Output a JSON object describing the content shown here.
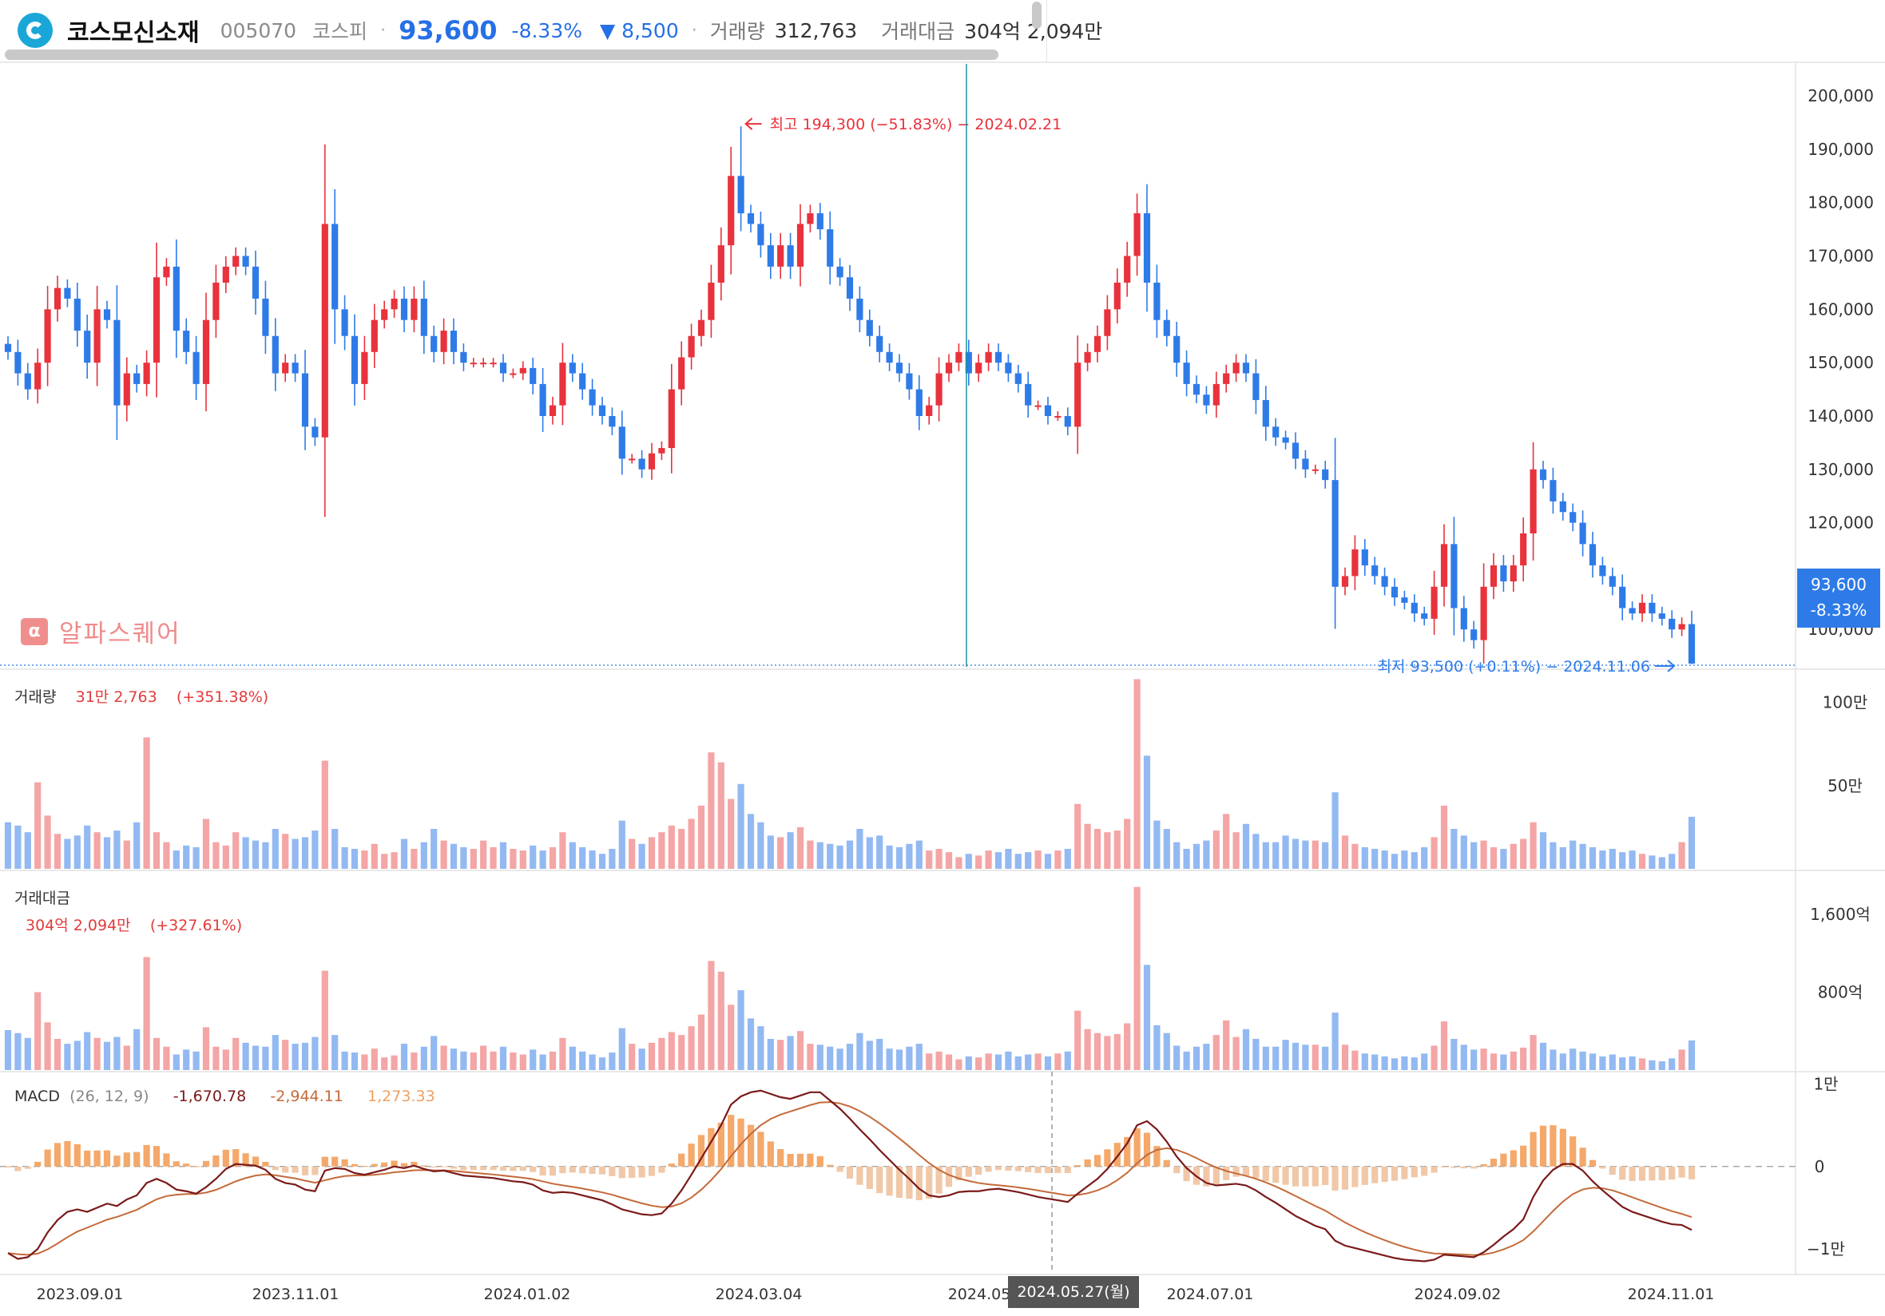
{
  "header": {
    "name": "코스모신소재",
    "code": "005070",
    "market": "코스피",
    "separator": "·",
    "price": "93,600",
    "change_rate": "-8.33%",
    "change_amount": "▼ 8,500",
    "volume_label": "거래량",
    "volume_value": "312,763",
    "amount_label": "거래대금",
    "amount_value": "304억 2,094만"
  },
  "brand": {
    "icon": "α",
    "text": "알파스퀘어"
  },
  "price_panel": {
    "high_annotation": "최고 194,300 (−51.83%) − 2024.02.21",
    "low_annotation": "최저 93,500 (+0.11%) − 2024.11.06",
    "current_badge_price": "93,600",
    "current_badge_rate": "-8.33%"
  },
  "volume_panel": {
    "label": "거래량",
    "value": "31만 2,763",
    "change": "(+351.38%)"
  },
  "amount_panel": {
    "label": "거래대금",
    "value": "304억 2,094만",
    "change": "(+327.61%)"
  },
  "macd_panel": {
    "label": "MACD",
    "params": "(26, 12, 9)",
    "macd": "-1,670.78",
    "signal": "-2,944.11",
    "hist": "1,273.33"
  },
  "crosshair_date": "2024.05.27(월)",
  "colors": {
    "up": "#e8323c",
    "down": "#2e7be8",
    "up_vol": "#f4a5a5",
    "down_vol": "#93b9f2",
    "macd": "#7a1a1a",
    "signal": "#c46a3a",
    "hist_pos": "#f4a86a",
    "hist_neg": "#f0c8a8"
  },
  "chart_data": [
    {
      "type": "candlestick",
      "series_name": "코스모신소재",
      "x_ticks": [
        "2023.09.01",
        "2023.11.01",
        "2024.01.02",
        "2024.03.04",
        "2024.05",
        "2024.07.01",
        "2024.09.02",
        "2024.11.01"
      ],
      "y_ticks": [
        "200,000",
        "190,000",
        "180,000",
        "170,000",
        "160,000",
        "150,000",
        "140,000",
        "130,000",
        "120,000",
        "110,000",
        "100,000"
      ],
      "ylim": [
        93000,
        206000
      ],
      "close": [
        152000,
        148000,
        145000,
        150000,
        160000,
        164000,
        162000,
        156000,
        150000,
        160000,
        158000,
        142000,
        148000,
        146000,
        150000,
        166000,
        168000,
        156000,
        152000,
        146000,
        158000,
        165000,
        168000,
        170000,
        168000,
        162000,
        155000,
        148000,
        150000,
        148000,
        138000,
        136000,
        176000,
        160000,
        155000,
        146000,
        152000,
        158000,
        160000,
        162000,
        158000,
        162000,
        155000,
        152000,
        156000,
        152000,
        150000,
        150000,
        150000,
        150000,
        148000,
        148000,
        149000,
        146000,
        140000,
        142000,
        150000,
        148000,
        145000,
        142000,
        140000,
        138000,
        132000,
        132000,
        130000,
        133000,
        134000,
        145000,
        151000,
        155000,
        158000,
        165000,
        172000,
        185000,
        178000,
        176000,
        172000,
        168000,
        172000,
        168000,
        176000,
        178000,
        175000,
        168000,
        166000,
        162000,
        158000,
        155000,
        152000,
        150000,
        148000,
        145000,
        140000,
        142000,
        148000,
        150000,
        152000,
        148000,
        150000,
        152000,
        150000,
        148000,
        146000,
        142000,
        142000,
        140000,
        140000,
        138000,
        150000,
        152000,
        155000,
        160000,
        165000,
        170000,
        178000,
        165000,
        158000,
        155000,
        150000,
        146000,
        144000,
        142000,
        146000,
        148000,
        150000,
        148000,
        143000,
        138000,
        136000,
        135000,
        132000,
        130000,
        130000,
        128000,
        108000,
        110000,
        115000,
        112000,
        110000,
        108000,
        106000,
        105000,
        103000,
        102000,
        108000,
        116000,
        104000,
        100000,
        98000,
        108000,
        112000,
        109000,
        112000,
        118000,
        130000,
        128000,
        124000,
        122000,
        120000,
        116000,
        112000,
        110000,
        108000,
        104000,
        103000,
        105000,
        103000,
        102000,
        100000,
        101000,
        93600
      ]
    },
    {
      "type": "bar",
      "series_name": "거래량",
      "y_ticks": [
        "100만",
        "50만"
      ],
      "ylim": [
        0,
        1200000
      ],
      "values": [
        280000,
        260000,
        220000,
        520000,
        320000,
        210000,
        180000,
        200000,
        260000,
        220000,
        190000,
        230000,
        170000,
        280000,
        790000,
        220000,
        160000,
        110000,
        140000,
        130000,
        300000,
        160000,
        140000,
        220000,
        190000,
        170000,
        160000,
        240000,
        210000,
        180000,
        190000,
        230000,
        650000,
        240000,
        130000,
        120000,
        110000,
        150000,
        90000,
        100000,
        180000,
        120000,
        160000,
        240000,
        170000,
        150000,
        130000,
        120000,
        170000,
        130000,
        160000,
        120000,
        110000,
        140000,
        110000,
        130000,
        220000,
        160000,
        130000,
        110000,
        90000,
        120000,
        290000,
        180000,
        150000,
        190000,
        220000,
        260000,
        240000,
        300000,
        380000,
        700000,
        640000,
        420000,
        510000,
        330000,
        280000,
        200000,
        190000,
        220000,
        250000,
        170000,
        160000,
        150000,
        140000,
        170000,
        240000,
        190000,
        200000,
        140000,
        130000,
        150000,
        170000,
        110000,
        120000,
        100000,
        70000,
        90000,
        80000,
        110000,
        100000,
        120000,
        90000,
        100000,
        110000,
        90000,
        110000,
        120000,
        390000,
        270000,
        240000,
        220000,
        230000,
        300000,
        1140000,
        680000,
        290000,
        240000,
        160000,
        120000,
        150000,
        170000,
        230000,
        330000,
        220000,
        270000,
        210000,
        160000,
        160000,
        200000,
        180000,
        170000,
        170000,
        160000,
        460000,
        200000,
        150000,
        130000,
        120000,
        110000,
        90000,
        110000,
        100000,
        130000,
        190000,
        380000,
        240000,
        200000,
        160000,
        170000,
        130000,
        120000,
        150000,
        180000,
        280000,
        220000,
        160000,
        130000,
        170000,
        150000,
        130000,
        110000,
        120000,
        100000,
        110000,
        90000,
        80000,
        70000,
        90000,
        160000,
        312763
      ]
    },
    {
      "type": "bar",
      "series_name": "거래대금",
      "y_ticks": [
        "1,600억",
        "800억"
      ],
      "ylim": [
        0,
        2050
      ],
      "values": [
        410,
        380,
        330,
        800,
        490,
        320,
        270,
        300,
        390,
        330,
        290,
        340,
        250,
        420,
        1160,
        330,
        240,
        160,
        210,
        190,
        440,
        240,
        210,
        330,
        280,
        250,
        240,
        360,
        310,
        270,
        280,
        340,
        1020,
        360,
        190,
        180,
        160,
        220,
        130,
        150,
        270,
        180,
        240,
        350,
        250,
        220,
        190,
        180,
        250,
        190,
        240,
        180,
        160,
        210,
        160,
        190,
        330,
        240,
        190,
        160,
        130,
        180,
        430,
        270,
        220,
        280,
        330,
        390,
        360,
        450,
        570,
        1120,
        1010,
        670,
        820,
        530,
        450,
        320,
        310,
        350,
        400,
        270,
        260,
        240,
        220,
        270,
        380,
        300,
        320,
        220,
        210,
        240,
        270,
        170,
        190,
        160,
        110,
        140,
        130,
        170,
        160,
        190,
        140,
        160,
        170,
        140,
        170,
        190,
        610,
        420,
        380,
        350,
        370,
        480,
        1880,
        1080,
        460,
        380,
        250,
        190,
        240,
        270,
        360,
        510,
        340,
        420,
        320,
        240,
        240,
        310,
        280,
        260,
        260,
        240,
        590,
        260,
        200,
        170,
        160,
        140,
        120,
        140,
        130,
        170,
        250,
        500,
        320,
        260,
        210,
        220,
        170,
        160,
        190,
        230,
        360,
        280,
        210,
        170,
        220,
        190,
        170,
        140,
        160,
        130,
        140,
        120,
        100,
        90,
        120,
        210,
        304
      ]
    },
    {
      "type": "line",
      "series_name": "MACD",
      "y_ticks": [
        "1만",
        "0",
        "−1만"
      ],
      "ylim": [
        -13000,
        11500
      ],
      "macd": [
        -10500,
        -11200,
        -11000,
        -10000,
        -8000,
        -6500,
        -5500,
        -5200,
        -5500,
        -5000,
        -4500,
        -4800,
        -4000,
        -3500,
        -2000,
        -1500,
        -2000,
        -2800,
        -3000,
        -3300,
        -2500,
        -1500,
        -300,
        300,
        200,
        100,
        -400,
        -1500,
        -2000,
        -2200,
        -2800,
        -3000,
        -500,
        -200,
        -300,
        -800,
        -1000,
        -700,
        -400,
        0,
        -200,
        100,
        -300,
        -600,
        -500,
        -800,
        -1100,
        -1200,
        -1300,
        -1400,
        -1600,
        -1800,
        -1900,
        -2200,
        -2900,
        -3200,
        -3100,
        -3200,
        -3500,
        -3800,
        -4100,
        -4600,
        -5200,
        -5500,
        -5800,
        -5900,
        -5700,
        -4500,
        -2900,
        -1000,
        1000,
        3000,
        5000,
        7500,
        8500,
        9000,
        9200,
        8800,
        8400,
        8200,
        8600,
        9000,
        9000,
        8000,
        7000,
        5800,
        4500,
        3300,
        2000,
        800,
        -400,
        -1500,
        -2700,
        -3500,
        -3700,
        -3500,
        -3100,
        -3000,
        -3000,
        -2800,
        -2700,
        -2900,
        -3100,
        -3400,
        -3700,
        -3900,
        -4100,
        -4300,
        -3300,
        -2400,
        -1500,
        -300,
        1200,
        2800,
        5000,
        5500,
        4500,
        3000,
        1200,
        -200,
        -1200,
        -2000,
        -2300,
        -2200,
        -2100,
        -2300,
        -2900,
        -3700,
        -4400,
        -5200,
        -6000,
        -6600,
        -7200,
        -7600,
        -9000,
        -9600,
        -9900,
        -10200,
        -10500,
        -10800,
        -11100,
        -11300,
        -11400,
        -11500,
        -11300,
        -10700,
        -10800,
        -10900,
        -11000,
        -10400,
        -9500,
        -8500,
        -7600,
        -6400,
        -3700,
        -1700,
        -400,
        300,
        300,
        -500,
        -1800,
        -2900,
        -3900,
        -4900,
        -5500,
        -5900,
        -6300,
        -6700,
        -7000,
        -7100,
        -7700
      ]
    }
  ]
}
